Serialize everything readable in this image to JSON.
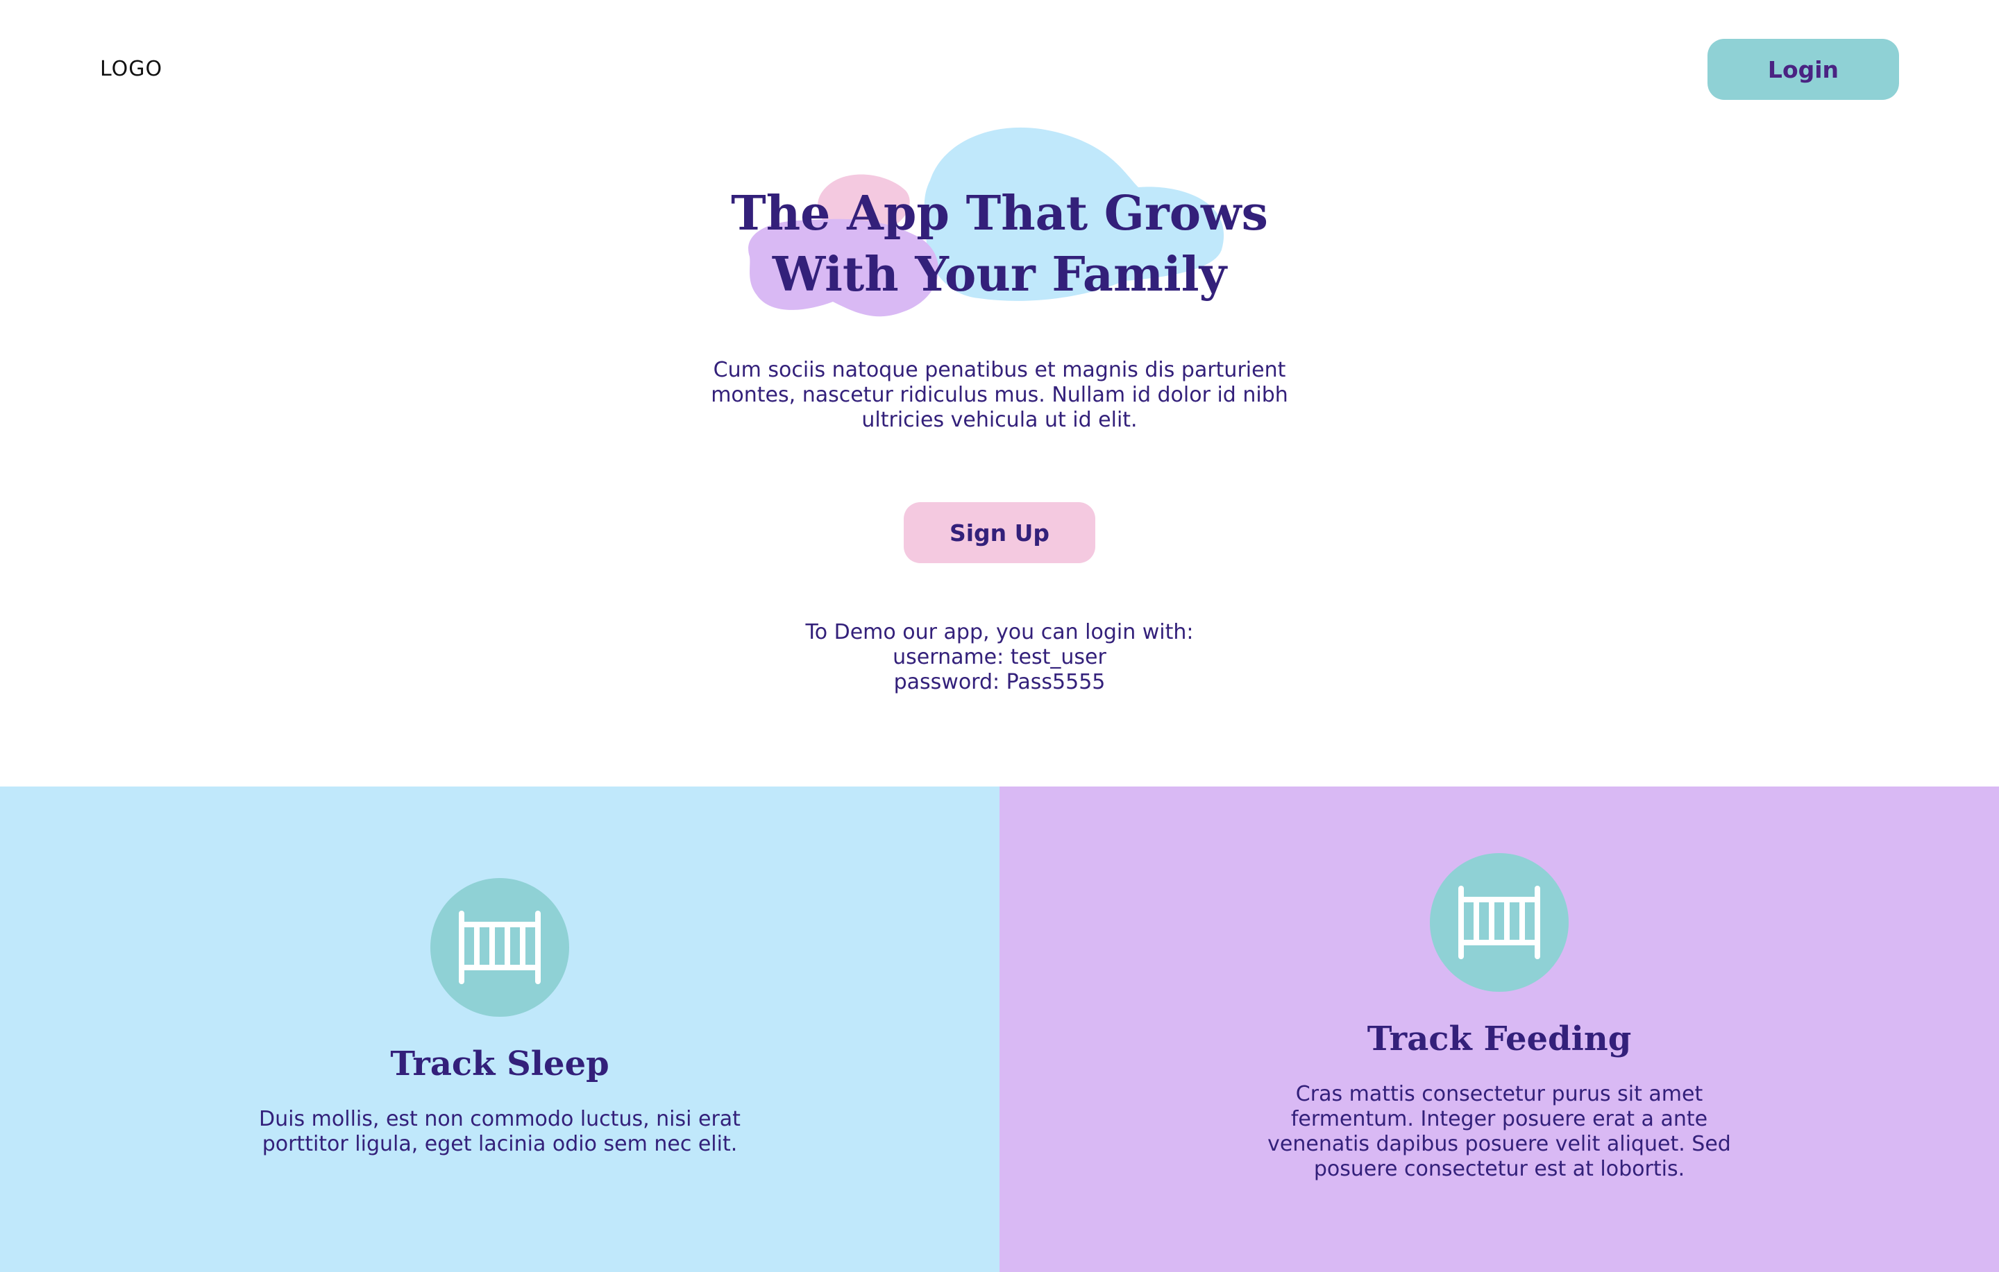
{
  "header": {
    "logo": "LOGO",
    "login_label": "Login"
  },
  "hero": {
    "title_line1": "The App That Grows",
    "title_line2": "With Your Family",
    "description": "Cum sociis natoque penatibus et magnis dis parturient montes, nascetur ridiculus mus. Nullam id dolor id nibh ultricies vehicula ut id elit.",
    "signup_label": "Sign Up",
    "demo_line1": "To Demo our app, you can login with:",
    "demo_line2": "username: test_user",
    "demo_line3": "password: Pass5555"
  },
  "features": [
    {
      "icon": "crib-icon",
      "title": "Track Sleep",
      "description": "Duis mollis, est non commodo luctus, nisi erat porttitor ligula, eget lacinia odio sem nec elit."
    },
    {
      "icon": "crib-icon",
      "title": "Track Feeding",
      "description": "Cras mattis consectetur purus sit amet fermentum. Integer posuere erat a ante venenatis dapibus posuere velit aliquet. Sed posuere consectetur est at lobortis."
    }
  ],
  "colors": {
    "primary_text": "#33207a",
    "login_button": "#8fd1d5",
    "signup_button": "#f4c9e0",
    "sleep_panel": "#c0e8fb",
    "feeding_panel": "#d9b9f4",
    "icon_circle": "#8fd1d5"
  }
}
